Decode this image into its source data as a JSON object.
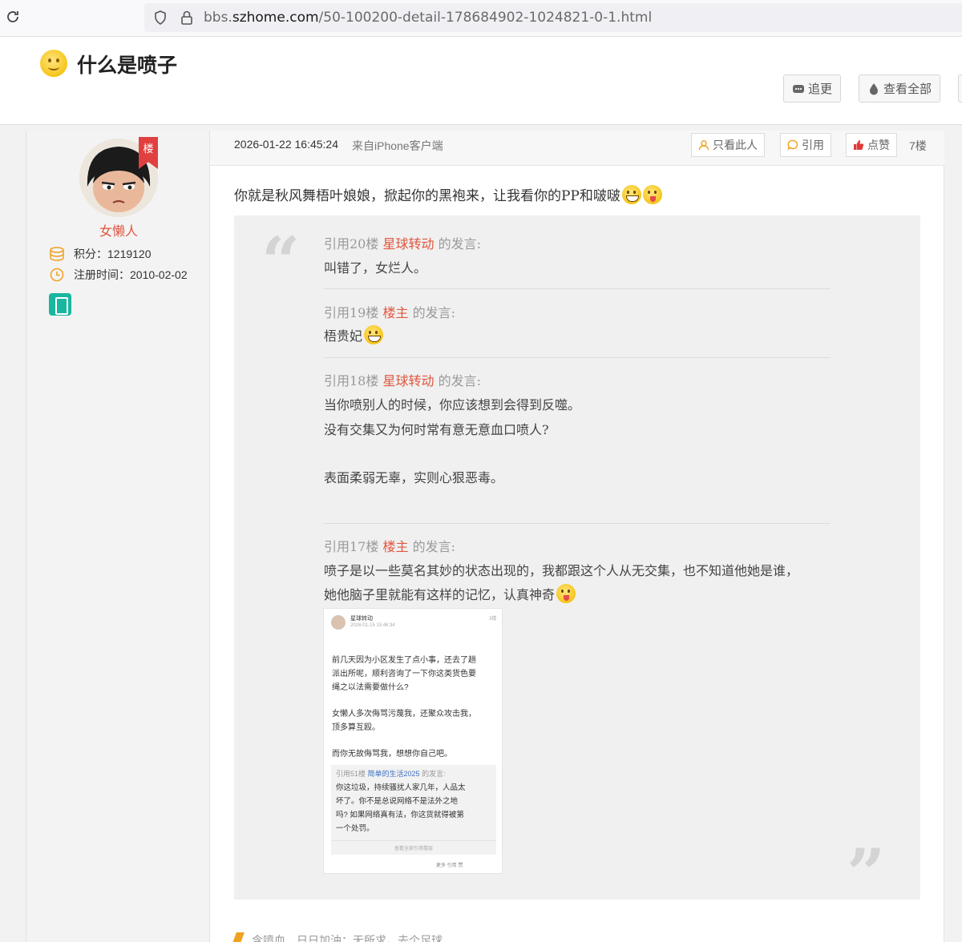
{
  "browser": {
    "url_prefix": "bbs.",
    "url_domain": "szhome.com",
    "url_path": "/50-100200-detail-178684902-1024821-0-1.html"
  },
  "header": {
    "title": "什么是喷子",
    "follow_label": "追更",
    "view_all_label": "查看全部"
  },
  "author": {
    "name": "女懒人",
    "badge": "楼",
    "points": "积分：1219120",
    "register": "注册时间：2010-02-02"
  },
  "post": {
    "time": "2026-01-22 16:45:24",
    "from": "来自iPhone客户端",
    "only_this_label": "只看此人",
    "quote_label": "引用",
    "like_label": "点赞",
    "floor": "7楼",
    "text": "你就是秋风舞梧叶娘娘，掀起你的黑袍来，让我看你的PP和啵啵"
  },
  "quotes": [
    {
      "prefix": "引用20楼",
      "who": "星球转动",
      "suffix": "的发言:",
      "lines": [
        "叫错了，女烂人。"
      ]
    },
    {
      "prefix": "引用19楼",
      "who": "楼主",
      "suffix": "的发言:",
      "lines": [
        "梧贵妃"
      ]
    },
    {
      "prefix": "引用18楼",
      "who": "星球转动",
      "suffix": "的发言:",
      "lines": [
        "当你喷别人的时候，你应该想到会得到反噬。",
        "没有交集又为何时常有意无意血口喷人?",
        "表面柔弱无辜，实则心狠恶毒。"
      ]
    },
    {
      "prefix": "引用17楼",
      "who": "楼主",
      "suffix": "的发言:",
      "lines": [
        "喷子是以一些莫名其妙的状态出现的，我都跟这个人从无交集，也不知道他她是谁，",
        "她他脑子里就能有这样的记忆，认真神奇"
      ]
    }
  ],
  "screenshot": {
    "name": "星球转动",
    "time": "2026-01-15 15:46:34",
    "floor": "3楼",
    "lines": [
      "前几天因为小区发生了点小事，还去了趟",
      "派出所呢，顺利咨询了一下你这类货色要",
      "绳之以法需要做什么?",
      "女懒人多次侮骂污蔑我，还聚众攻击我，",
      "顶多算互殴。",
      "而你无故侮骂我，想想你自己吧。"
    ],
    "quote_prefix": "引用51楼",
    "quote_who": "简单的生活2025",
    "quote_suffix": "的发言:",
    "quote_lines": [
      "你这垃圾，持续骚扰人家几年，人品太",
      "坏了。你不是总说网络不是法外之地",
      "吗? 如果网络真有法，你这货就得被第",
      "一个处罚。"
    ],
    "quote_more": "查看全部引用楼层",
    "footer": "更多   引用   赞"
  },
  "signature": "含喷血　日日加油；无所求，去个足球"
}
